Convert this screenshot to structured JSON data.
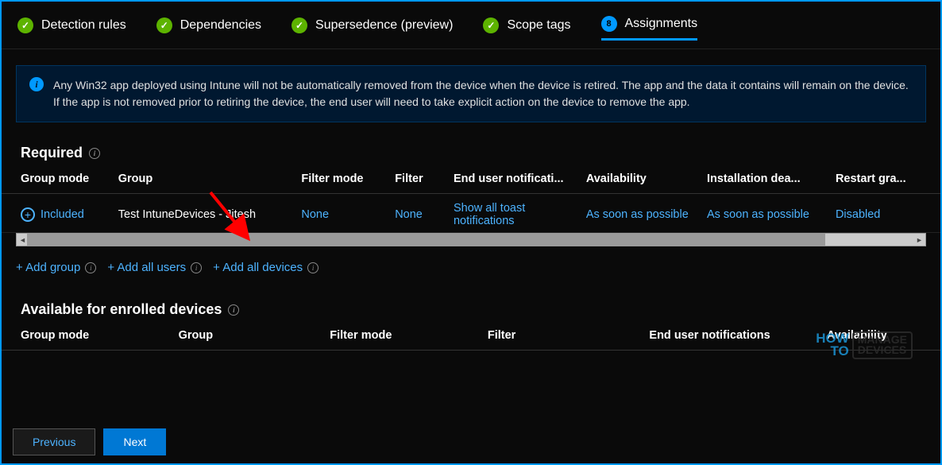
{
  "tabs": [
    {
      "label": "Detection rules",
      "done": true
    },
    {
      "label": "Dependencies",
      "done": true
    },
    {
      "label": "Supersedence (preview)",
      "done": true
    },
    {
      "label": "Scope tags",
      "done": true
    },
    {
      "label": "Assignments",
      "step": "8",
      "active": true
    }
  ],
  "banner": {
    "text": "Any Win32 app deployed using Intune will not be automatically removed from the device when the device is retired. The app and the data it contains will remain on the device. If the app is not removed prior to retiring the device, the end user will need to take explicit action on the device to remove the app."
  },
  "sections": {
    "required": {
      "title": "Required",
      "columns": [
        "Group mode",
        "Group",
        "Filter mode",
        "Filter",
        "End user notificati...",
        "Availability",
        "Installation dea...",
        "Restart gra..."
      ],
      "rows": [
        {
          "mode": "Included",
          "group": "Test IntuneDevices - Jitesh",
          "filter_mode": "None",
          "filter": "None",
          "notifications": "Show all toast notifications",
          "availability": "As soon as possible",
          "deadline": "As soon as possible",
          "restart": "Disabled"
        }
      ]
    },
    "available": {
      "title": "Available for enrolled devices",
      "columns": [
        "Group mode",
        "Group",
        "Filter mode",
        "Filter",
        "End user notifications",
        "Availability"
      ]
    }
  },
  "action_links": {
    "add_group": "+ Add group",
    "add_users": "+ Add all users",
    "add_devices": "+ Add all devices"
  },
  "buttons": {
    "previous": "Previous",
    "next": "Next"
  },
  "watermark": {
    "how": "HOW",
    "to": "TO",
    "manage": "MANAGE",
    "devices": "DEVICES"
  }
}
